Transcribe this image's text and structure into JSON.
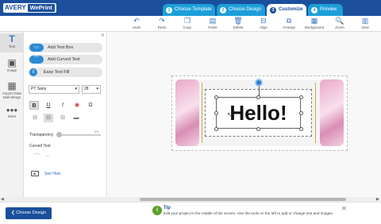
{
  "brand": {
    "avery": "AVERY",
    "weprint": "WePrint"
  },
  "steps": [
    {
      "num": "1",
      "label": "Choose Template"
    },
    {
      "num": "2",
      "label": "Choose Design"
    },
    {
      "num": "3",
      "label": "Customize"
    },
    {
      "num": "4",
      "label": "Preview"
    }
  ],
  "toolbar": [
    "Undo",
    "Redo",
    "Copy",
    "Paste",
    "Delete",
    "Align",
    "Arrange",
    "Background",
    "Zoom",
    "View"
  ],
  "rail": [
    "Text",
    "Image",
    "Import Data Mail Merge",
    "More"
  ],
  "panel": {
    "add_text_box": "Add Text Box",
    "add_curved_text": "Add Curved Text",
    "easy_text_fill": "Easy Text Fill",
    "font": "PT Sans",
    "size": "28",
    "transparency_label": "Transparency",
    "transparency_value": "0%",
    "curved_text_label": "Curved Text",
    "see_how": "See How"
  },
  "canvas": {
    "text": "Hello!"
  },
  "bottom": {
    "back_button": "Choose Design"
  },
  "tip": {
    "title": "Tip",
    "text": "Edit your project in the middle of the screen. Use the tools on the left to add or change text and images."
  },
  "colors": {
    "brand_blue": "#1b4f9c",
    "step_blue": "#1d9fd9",
    "accent": "#2a8ad4",
    "tip_green": "#5aa028"
  }
}
